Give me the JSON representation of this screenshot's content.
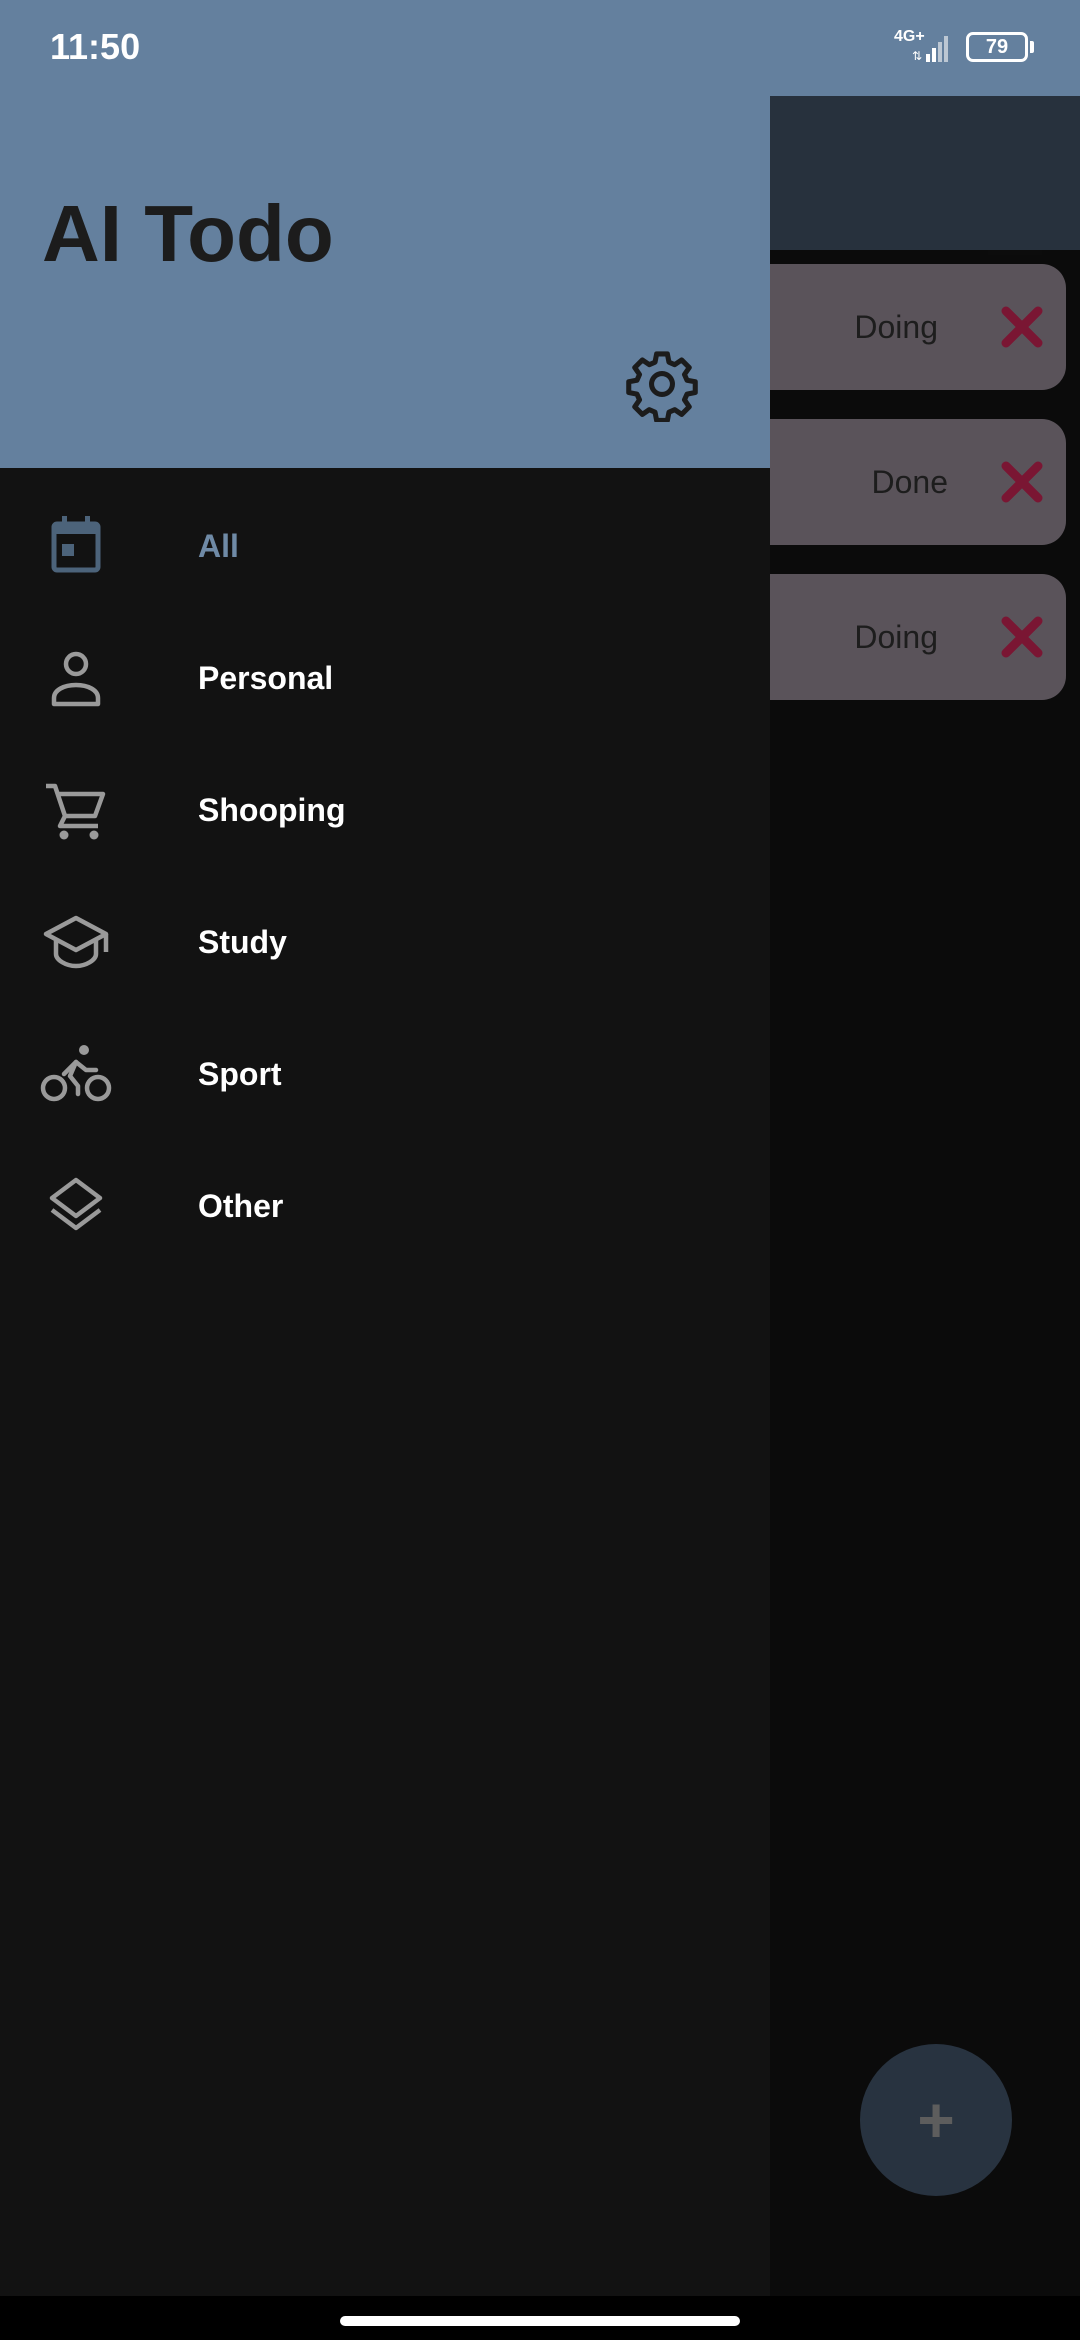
{
  "status_bar": {
    "time": "11:50",
    "network": "4G+",
    "battery": "79"
  },
  "drawer": {
    "app_title": "AI Todo",
    "items": [
      {
        "label": "All",
        "icon": "calendar-icon",
        "selected": true
      },
      {
        "label": "Personal",
        "icon": "person-icon",
        "selected": false
      },
      {
        "label": "Shooping",
        "icon": "cart-icon",
        "selected": false
      },
      {
        "label": "Study",
        "icon": "school-icon",
        "selected": false
      },
      {
        "label": "Sport",
        "icon": "bike-icon",
        "selected": false
      },
      {
        "label": "Other",
        "icon": "layers-icon",
        "selected": false
      }
    ]
  },
  "background": {
    "tasks": [
      {
        "status": "Doing"
      },
      {
        "status": "Done"
      },
      {
        "status": "Doing"
      }
    ],
    "fab_label": "+"
  },
  "colors": {
    "header": "#64809e",
    "drawer_bg": "#121212",
    "selected_text": "#6f8aa6",
    "delete_icon": "#7a1633"
  }
}
